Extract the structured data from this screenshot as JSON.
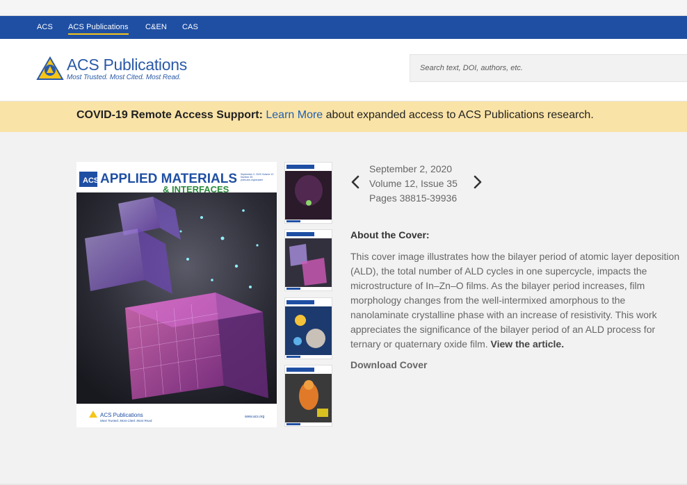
{
  "network_bar": {
    "links": [
      {
        "label": "ACS",
        "active": false
      },
      {
        "label": "ACS Publications",
        "active": true
      },
      {
        "label": "C&EN",
        "active": false
      },
      {
        "label": "CAS",
        "active": false
      }
    ]
  },
  "header": {
    "logo": {
      "name": "ACS Publications",
      "tagline": "Most Trusted. Most Cited. Most Read."
    },
    "search": {
      "placeholder": "Search text, DOI, authors, etc."
    }
  },
  "covid_banner": {
    "bold_text": "COVID-19 Remote Access Support:",
    "link_text": "Learn More",
    "rest_text": " about expanded access to ACS Publications research."
  },
  "cover": {
    "journal_prefix": "ACS",
    "journal_title_line1": "APPLIED MATERIALS",
    "journal_title_line2": "& INTERFACES",
    "corner_info": "September 2, 2020 Volume 12 Number 35 pubs.acs.org/acsami",
    "footer_logo": "ACS Publications",
    "footer_tagline": "Most Trusted. Most Cited. Most Read.",
    "footer_url": "www.acs.org"
  },
  "thumbnails": [
    "thumb-1",
    "thumb-2",
    "thumb-3",
    "thumb-4"
  ],
  "issue": {
    "date": "September 2, 2020",
    "volume": "Volume 12, Issue 35",
    "pages": "Pages 38815-39936"
  },
  "about": {
    "title": "About the Cover:",
    "body": "This cover image illustrates how the bilayer period of atomic layer deposition (ALD), the total number of ALD cycles in one supercycle, impacts the microstructure of In–Zn–O films. As the bilayer period increases, film morphology changes from the well-intermixed amorphous to the nanolaminate crystalline phase with an increase of resistivity. This work appreciates the significance of the bilayer period of an ALD process for ternary or quaternary oxide film.",
    "link_text": "View the article.",
    "download_text": "Download Cover"
  },
  "colors": {
    "network_bar": "#1f4fa3",
    "accent_yellow": "#f5c518",
    "banner_bg": "#fae3a6",
    "link_blue": "#1f5fb0",
    "logo_blue": "#2a5aa8"
  }
}
